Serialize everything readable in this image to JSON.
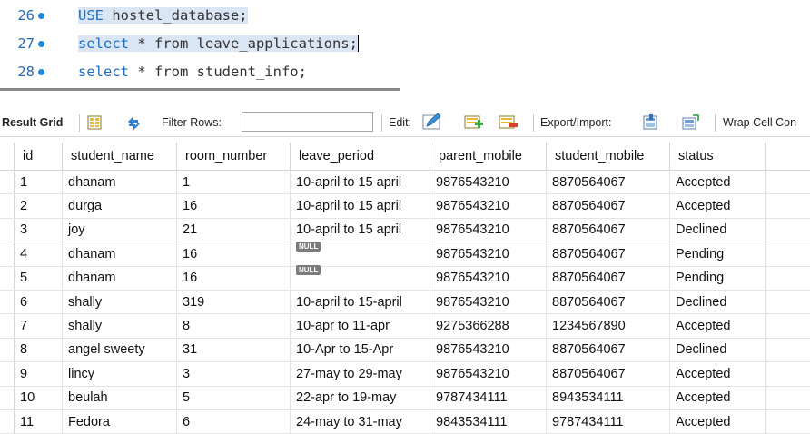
{
  "editor": {
    "lines": [
      {
        "number": "26",
        "keyword": "USE",
        "rest": " hostel_database;",
        "highlight": true
      },
      {
        "number": "27",
        "keyword": "select",
        "rest": " * from leave_applications;",
        "highlight": true
      },
      {
        "number": "28",
        "keyword": "select",
        "rest": " * from student_info;",
        "highlight": false
      }
    ]
  },
  "toolbar": {
    "result_grid_label": "Result Grid",
    "filter_rows_label": "Filter Rows:",
    "filter_rows_value": "",
    "edit_label": "Edit:",
    "export_import_label": "Export/Import:",
    "wrap_cell_label": "Wrap Cell Con"
  },
  "grid": {
    "columns": [
      "id",
      "student_name",
      "room_number",
      "leave_period",
      "parent_mobile",
      "student_mobile",
      "status"
    ],
    "null_label": "NULL",
    "rows": [
      {
        "id": "1",
        "student_name": "dhanam",
        "room_number": "1",
        "leave_period": "10-april to 15 april",
        "parent_mobile": "9876543210",
        "student_mobile": "8870564067",
        "status": "Accepted"
      },
      {
        "id": "2",
        "student_name": "durga",
        "room_number": "16",
        "leave_period": "10-april to 15 april",
        "parent_mobile": "9876543210",
        "student_mobile": "8870564067",
        "status": "Accepted"
      },
      {
        "id": "3",
        "student_name": "joy",
        "room_number": "21",
        "leave_period": "10-april to 15 april",
        "parent_mobile": "9876543210",
        "student_mobile": "8870564067",
        "status": "Declined"
      },
      {
        "id": "4",
        "student_name": "dhanam",
        "room_number": "16",
        "leave_period": null,
        "parent_mobile": "9876543210",
        "student_mobile": "8870564067",
        "status": "Pending"
      },
      {
        "id": "5",
        "student_name": "dhanam",
        "room_number": "16",
        "leave_period": null,
        "parent_mobile": "9876543210",
        "student_mobile": "8870564067",
        "status": "Pending"
      },
      {
        "id": "6",
        "student_name": "shally",
        "room_number": "319",
        "leave_period": "10-april to 15-april",
        "parent_mobile": "9876543210",
        "student_mobile": "8870564067",
        "status": "Declined"
      },
      {
        "id": "7",
        "student_name": "shally",
        "room_number": "8",
        "leave_period": "10-apr to 11-apr",
        "parent_mobile": "9275366288",
        "student_mobile": "1234567890",
        "status": "Accepted"
      },
      {
        "id": "8",
        "student_name": "angel sweety",
        "room_number": "31",
        "leave_period": "10-Apr to 15-Apr",
        "parent_mobile": "9876543210",
        "student_mobile": "8870564067",
        "status": "Declined"
      },
      {
        "id": "9",
        "student_name": "lincy",
        "room_number": "3",
        "leave_period": "27-may to 29-may",
        "parent_mobile": "9876543210",
        "student_mobile": "8870564067",
        "status": "Accepted"
      },
      {
        "id": "10",
        "student_name": "beulah",
        "room_number": "5",
        "leave_period": "22-apr to 19-may",
        "parent_mobile": "9787434111",
        "student_mobile": "8943534111",
        "status": "Accepted"
      },
      {
        "id": "11",
        "student_name": "Fedora",
        "room_number": "6",
        "leave_period": "24-may to 31-may",
        "parent_mobile": "9843534111",
        "student_mobile": "9787434111",
        "status": "Accepted"
      }
    ]
  }
}
